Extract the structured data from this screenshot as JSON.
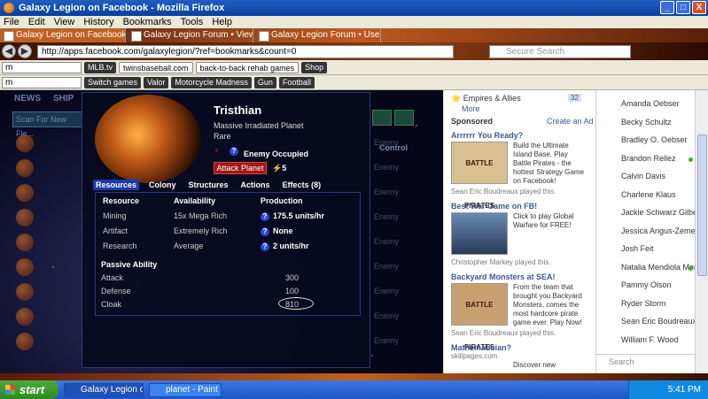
{
  "window": {
    "title": "Galaxy Legion on Facebook - Mozilla Firefox",
    "min": "_",
    "max": "□",
    "close": "X"
  },
  "menu": [
    "File",
    "Edit",
    "View",
    "History",
    "Bookmarks",
    "Tools",
    "Help"
  ],
  "tabs": [
    {
      "label": "Galaxy Legion on Facebook",
      "active": true
    },
    {
      "label": "Galaxy Legion Forum • View top...",
      "active": false
    },
    {
      "label": "Galaxy Legion Forum • User Co...",
      "active": false
    }
  ],
  "nav": {
    "url": "http://apps.facebook.com/galaxylegion/?ref=bookmarks&count=0",
    "search_placeholder": "Secure Search"
  },
  "toolbar1": {
    "select_value": "m",
    "chips": [
      "MLB.tv",
      "twinsbaseball.com",
      "back-to-back rehab games",
      "Shop"
    ]
  },
  "toolbar2": {
    "select_value": "m",
    "chips": [
      "Switch games",
      "Valor",
      "Motorcycle Madness",
      "Gun",
      "Football"
    ]
  },
  "game": {
    "nav": [
      "NEWS",
      "SHIP"
    ],
    "scan_button": "Scan For New Fle...",
    "control_header": "Control",
    "bg_enemy_label": "Enemy",
    "bg_rows": 9
  },
  "planet": {
    "name": "Tristhian",
    "type": "Massive Irradiated Planet",
    "rarity": "Rare",
    "occupied_status": "Enemy Occupied",
    "attack_button": "Attack Planet",
    "attack_count": "5",
    "tabs": [
      {
        "label": "Resources",
        "active": true
      },
      {
        "label": "Colony",
        "active": false
      },
      {
        "label": "Structures",
        "active": false
      },
      {
        "label": "Actions",
        "active": false
      },
      {
        "label": "Effects (8)",
        "active": false
      }
    ],
    "resource_headers": {
      "resource": "Resource",
      "availability": "Availability",
      "production": "Production"
    },
    "resources": [
      {
        "name": "Mining",
        "availability": "15x Mega Rich",
        "production": "175.5 units/hr"
      },
      {
        "name": "Artifact",
        "availability": "Extremely Rich",
        "production": "None"
      },
      {
        "name": "Research",
        "availability": "Average",
        "production": "2 units/hr"
      }
    ],
    "passive_ability_header": "Passive Ability",
    "passive": [
      {
        "label": "Attack",
        "value": "300"
      },
      {
        "label": "Defense",
        "value": "100"
      },
      {
        "label": "Cloak",
        "value": "810"
      }
    ]
  },
  "facebook": {
    "app_name": "Empires & Allies",
    "app_badge": "32",
    "more": "More",
    "sponsored": "Sponsored",
    "create_ad": "Create an Ad",
    "ads": [
      {
        "title": "Arrrrrr You Ready?",
        "desc": "Build the Ultimate Island Base. Play Battle Pirates - the hottest Strategy Game on Facebook!",
        "liked": "Sean Eric Boudreaux played this.",
        "img_text": "BATTLE PIRATES"
      },
      {
        "title": "Best War Game on FB!",
        "desc": "Click to play Global Warfare for FREE!",
        "liked": "Christopher Markey played this.",
        "img_text": ""
      },
      {
        "title": "Backyard Monsters at SEA!",
        "desc": "From the team that brought you Backyard Monsters, comes the most hardcore pirate game ever. Play Now!",
        "liked": "Sean Eric Boudreaux played this.",
        "img_text": "BATTLE PIRATES"
      },
      {
        "title": "Mathematician?",
        "desc": "Discover new",
        "liked": "skillpages.com",
        "img_text": ""
      }
    ]
  },
  "friends": {
    "list": [
      {
        "name": "Amanda Oebser",
        "online": false
      },
      {
        "name": "Becky Schultz",
        "online": false
      },
      {
        "name": "Bradley O. Oebser",
        "online": false
      },
      {
        "name": "Brandon Rellez",
        "online": true
      },
      {
        "name": "Calvin Davis",
        "online": false
      },
      {
        "name": "Charlene Klaus",
        "online": false
      },
      {
        "name": "Jackie Schwarz Gilbert",
        "online": false
      },
      {
        "name": "Jessica Angus-Zemek",
        "online": false
      },
      {
        "name": "Josh Feit",
        "online": false
      },
      {
        "name": "Natalia Mendiola Menkir",
        "online": true
      },
      {
        "name": "Pammy Olson",
        "online": false
      },
      {
        "name": "Ryder Storm",
        "online": false
      },
      {
        "name": "Sean Eric Boudreaux",
        "online": false
      },
      {
        "name": "William F. Wood",
        "online": false
      }
    ],
    "search_placeholder": "Search"
  },
  "taskbar": {
    "start": "start",
    "tasks": [
      {
        "label": "Galaxy Legion o...",
        "active": true
      },
      {
        "label": "planet - Paint",
        "active": false
      }
    ],
    "clock": "5:41 PM"
  }
}
